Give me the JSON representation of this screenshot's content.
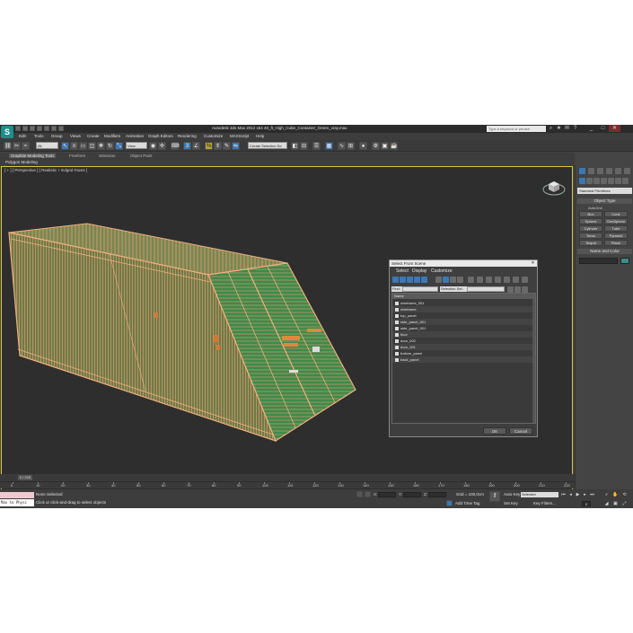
{
  "app": {
    "logo": "S",
    "title": "Autodesk 3ds Max  2012 x64      40_ft_High_Cube_Container_Green_vray.max",
    "search_placeholder": "Type a keyword or phrase",
    "window_controls": [
      "_",
      "□",
      "✕"
    ]
  },
  "menu": [
    "Edit",
    "Tools",
    "Group",
    "Views",
    "Create",
    "Modifiers",
    "Animation",
    "Graph Editors",
    "Rendering",
    "Customize",
    "MAXScript",
    "Help"
  ],
  "toolbar": {
    "filter_value": "All",
    "view_value": "View",
    "selection_set_value": "Create Selection Se"
  },
  "ribbon": {
    "tabs": [
      "Graphite Modeling Tools",
      "Freeform",
      "Selection",
      "Object Paint"
    ],
    "active_tab": "Graphite Modeling Tools",
    "panel_label": "Polygon Modeling"
  },
  "viewport": {
    "label": "[ + ] [ Perspective ] [ Realistic + Edged Faces ]"
  },
  "command_panel": {
    "primitive_type": "Standard Primitives",
    "object_type_title": "Object Type",
    "autogrid_label": "AutoGrid",
    "buttons": [
      "Box",
      "Cone",
      "Sphere",
      "GeoSphere",
      "Cylinder",
      "Tube",
      "Torus",
      "Pyramid",
      "Teapot",
      "Plane"
    ],
    "name_color_title": "Name and Color"
  },
  "dialog": {
    "title": "Select From Scene",
    "close": "✕",
    "menu": [
      "Select",
      "Display",
      "Customize"
    ],
    "find_label": "Find:",
    "selection_set_label": "Selection Set:",
    "column_header": "Name",
    "items": [
      "wireframe_001",
      "wireframe",
      "top_panel",
      "side_panel_001",
      "side_panel_001",
      "floor",
      "door_002",
      "door_001",
      "bottom_panel",
      "back_panel"
    ],
    "ok_label": "OK",
    "cancel_label": "Cancel"
  },
  "timeline": {
    "frame_counter": "0 / 225",
    "ticks": [
      "0",
      "10",
      "20",
      "30",
      "40",
      "50",
      "60",
      "70",
      "80",
      "90",
      "100",
      "110",
      "120",
      "130",
      "140",
      "150",
      "160",
      "170",
      "180",
      "190",
      "200",
      "210",
      "220"
    ]
  },
  "status": {
    "maxscript_text": "Max to Physc",
    "selection_text": "None Selected",
    "prompt_text": "Click or click-and-drag to select objects",
    "coord_labels": [
      "X:",
      "Y:",
      "Z:"
    ],
    "grid_text": "Grid = 100,0cm",
    "add_time_tag": "Add Time Tag",
    "auto_key": "Auto Key",
    "auto_key_value": "Selected",
    "set_key": "Set Key",
    "key_filters": "Key Filters...",
    "current_frame": "0"
  }
}
